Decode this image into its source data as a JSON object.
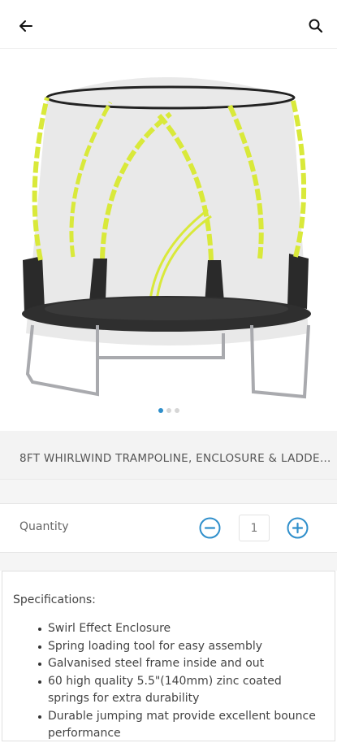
{
  "header": {
    "back_icon": "arrow-left-icon",
    "search_icon": "search-icon"
  },
  "gallery": {
    "image_subject": "trampoline with enclosure",
    "dot_count": 3,
    "active_index": 0
  },
  "product": {
    "title": "8FT WHIRLWIND TRAMPOLINE, ENCLOSURE & LADDER..."
  },
  "quantity": {
    "label": "Quantity",
    "value": "1",
    "accent": "#2f8fcb"
  },
  "specifications": {
    "heading": "Specifications:",
    "items": [
      "Swirl Effect Enclosure",
      "Spring loading tool for easy assembly",
      "Galvanised steel frame inside and out",
      "60 high quality 5.5\"(140mm) zinc coated springs for extra durability",
      "Durable jumping mat provide excellent bounce performance"
    ]
  }
}
